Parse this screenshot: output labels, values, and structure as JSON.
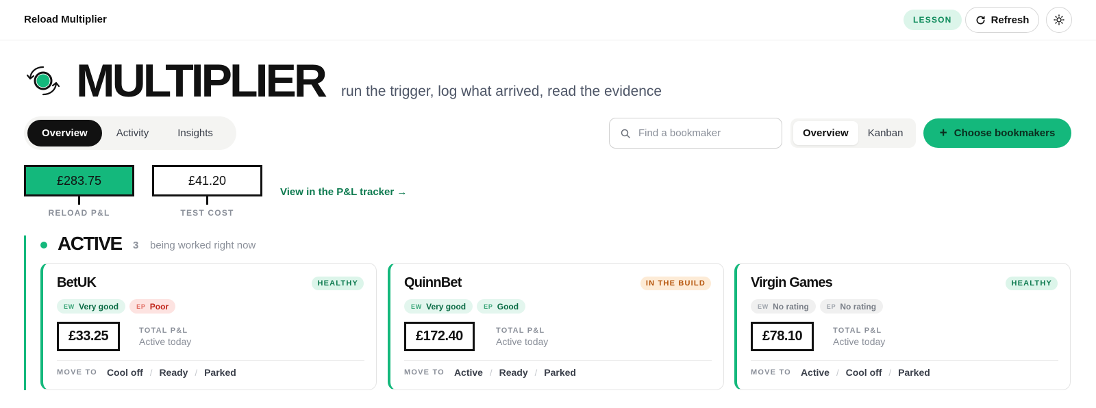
{
  "header": {
    "app_title": "Reload Multiplier",
    "lesson_badge": "LESSON",
    "refresh_label": "Refresh"
  },
  "hero": {
    "title": "MULTIPLIER",
    "subtitle": "run the trigger, log what arrived, read the evidence"
  },
  "tabs": [
    {
      "label": "Overview",
      "active": true
    },
    {
      "label": "Activity",
      "active": false
    },
    {
      "label": "Insights",
      "active": false
    }
  ],
  "search": {
    "placeholder": "Find a bookmaker",
    "value": ""
  },
  "view_toggle": [
    {
      "label": "Overview",
      "active": true
    },
    {
      "label": "Kanban",
      "active": false
    }
  ],
  "choose_button": {
    "label": "Choose bookmakers"
  },
  "stats": [
    {
      "value": "£283.75",
      "label": "RELOAD P&L"
    },
    {
      "value": "£41.20",
      "label": "TEST COST"
    }
  ],
  "pl_link": "View in the P&L tracker →",
  "section": {
    "title": "ACTIVE",
    "count": "3",
    "description": "being worked right now"
  },
  "cards": [
    {
      "name": "BetUK",
      "status": "HEALTHY",
      "chips": [
        {
          "key": "EW",
          "value": "Very good"
        },
        {
          "key": "EP",
          "value": "Poor"
        }
      ],
      "total_pl": "£33.25",
      "pl_label": "TOTAL P&L",
      "pl_sub": "Active today",
      "move_label": "MOVE TO",
      "moves": [
        "Cool off",
        "Ready",
        "Parked"
      ]
    },
    {
      "name": "QuinnBet",
      "status": "IN THE BUILD",
      "chips": [
        {
          "key": "EW",
          "value": "Very good"
        },
        {
          "key": "EP",
          "value": "Good"
        }
      ],
      "total_pl": "£172.40",
      "pl_label": "TOTAL P&L",
      "pl_sub": "Active today",
      "move_label": "MOVE TO",
      "moves": [
        "Active",
        "Ready",
        "Parked"
      ]
    },
    {
      "name": "Virgin Games",
      "status": "HEALTHY",
      "chips": [
        {
          "key": "EW",
          "value": "No rating"
        },
        {
          "key": "EP",
          "value": "No rating"
        }
      ],
      "total_pl": "£78.10",
      "pl_label": "TOTAL P&L",
      "pl_sub": "Active today",
      "move_label": "MOVE TO",
      "moves": [
        "Active",
        "Cool off",
        "Parked"
      ]
    }
  ],
  "colors": {
    "accent": "#14b87c",
    "accent_dark": "#0d7a4f",
    "warning_bg": "#fdebd6",
    "warning_text": "#b5540a",
    "poor_bg": "#fde3e1",
    "poor_text": "#c0241a"
  },
  "icons": {
    "logo": "reload-cycle-icon",
    "refresh": "refresh-icon",
    "theme": "sun-icon",
    "search": "search-icon",
    "add": "plus-icon"
  }
}
